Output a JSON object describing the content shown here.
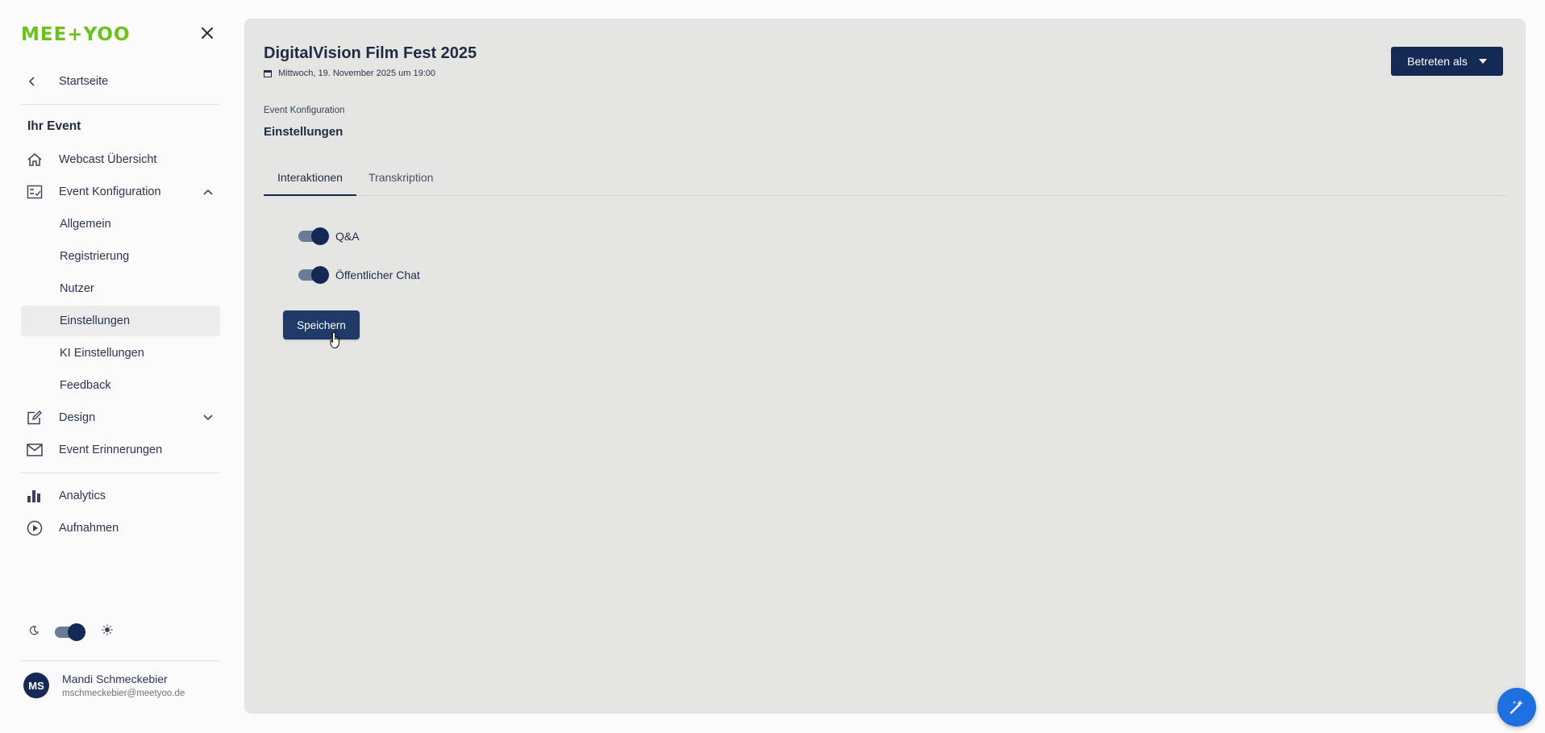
{
  "brand": {
    "logo_text": "MEE+YOO",
    "logo_color": "#6cc11f"
  },
  "sidebar": {
    "back_label": "Startseite",
    "section_title": "Ihr Event",
    "items": [
      {
        "label": "Webcast Übersicht",
        "icon": "home-icon"
      },
      {
        "label": "Event Konfiguration",
        "icon": "checklist-icon",
        "expanded": true,
        "children": [
          "Allgemein",
          "Registrierung",
          "Nutzer",
          "Einstellungen",
          "KI Einstellungen",
          "Feedback"
        ],
        "active_child": "Einstellungen"
      },
      {
        "label": "Design",
        "icon": "edit-icon",
        "expanded": false
      },
      {
        "label": "Event Erinnerungen",
        "icon": "mail-icon"
      },
      {
        "label": "Analytics",
        "icon": "bar-chart-icon"
      },
      {
        "label": "Aufnahmen",
        "icon": "play-circle-icon"
      }
    ],
    "theme_toggle": {
      "dark_icon": "moon-icon",
      "light_icon": "sun-icon",
      "value": "light"
    },
    "user": {
      "initials": "MS",
      "name": "Mandi Schmeckebier",
      "email": "mschmeckebier@meetyoo.de"
    }
  },
  "header": {
    "event_title": "DigitalVision Film Fest 2025",
    "event_date": "Mittwoch, 19. November 2025 um 19:00",
    "enter_button": "Betreten als"
  },
  "main": {
    "breadcrumb": "Event Konfiguration",
    "page_title": "Einstellungen",
    "tabs": [
      {
        "label": "Interaktionen",
        "active": true
      },
      {
        "label": "Transkription",
        "active": false
      }
    ],
    "toggles": [
      {
        "label": "Q&A",
        "on": true
      },
      {
        "label": "Öffentlicher Chat",
        "on": true
      }
    ],
    "save_button": "Speichern"
  },
  "colors": {
    "primary": "#142a55",
    "fab": "#1e6fe0",
    "panel_bg": "#e5e5e3"
  }
}
